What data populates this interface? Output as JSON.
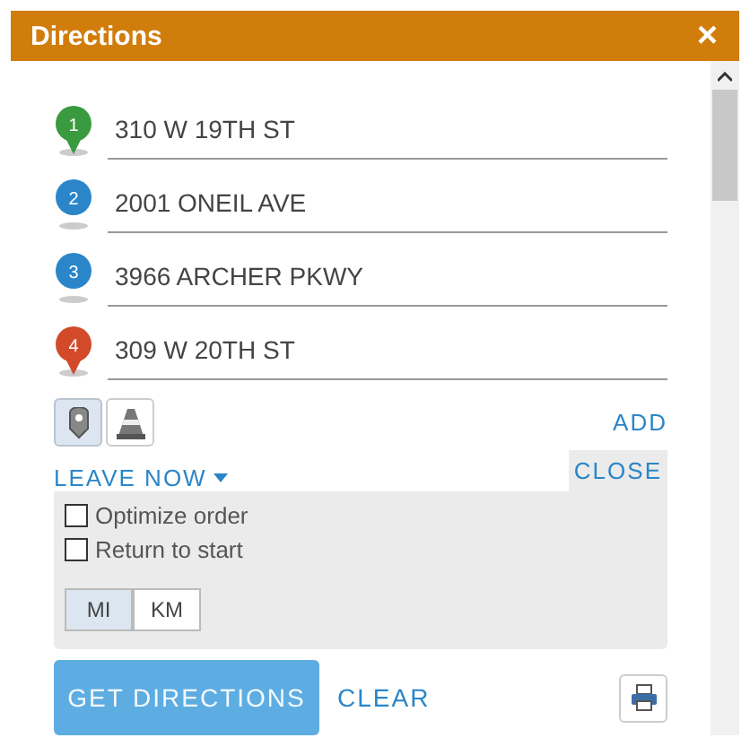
{
  "window": {
    "title": "Directions",
    "close": "×"
  },
  "stops": [
    {
      "number": "1",
      "address": "310 W 19TH ST",
      "color": "#3a9a3f"
    },
    {
      "number": "2",
      "address": "2001 ONEIL AVE",
      "color": "#2a86c8"
    },
    {
      "number": "3",
      "address": "3966 ARCHER PKWY",
      "color": "#2a86c8"
    },
    {
      "number": "4",
      "address": "309 W 20TH ST",
      "color": "#d24a2a"
    }
  ],
  "travel_modes": [
    {
      "kind": "car",
      "selected": true
    },
    {
      "kind": "truck",
      "selected": false
    }
  ],
  "add": "ADD",
  "leave_now": "LEAVE NOW",
  "options_toggle": "CLOSE",
  "options": [
    {
      "label": "Optimize order",
      "checked": false
    },
    {
      "label": "Return to start",
      "checked": false
    }
  ],
  "units": [
    {
      "label": "MI",
      "selected": true
    },
    {
      "label": "KM",
      "selected": false
    }
  ],
  "get_directions": "GET DIRECTIONS",
  "clear": "CLEAR"
}
